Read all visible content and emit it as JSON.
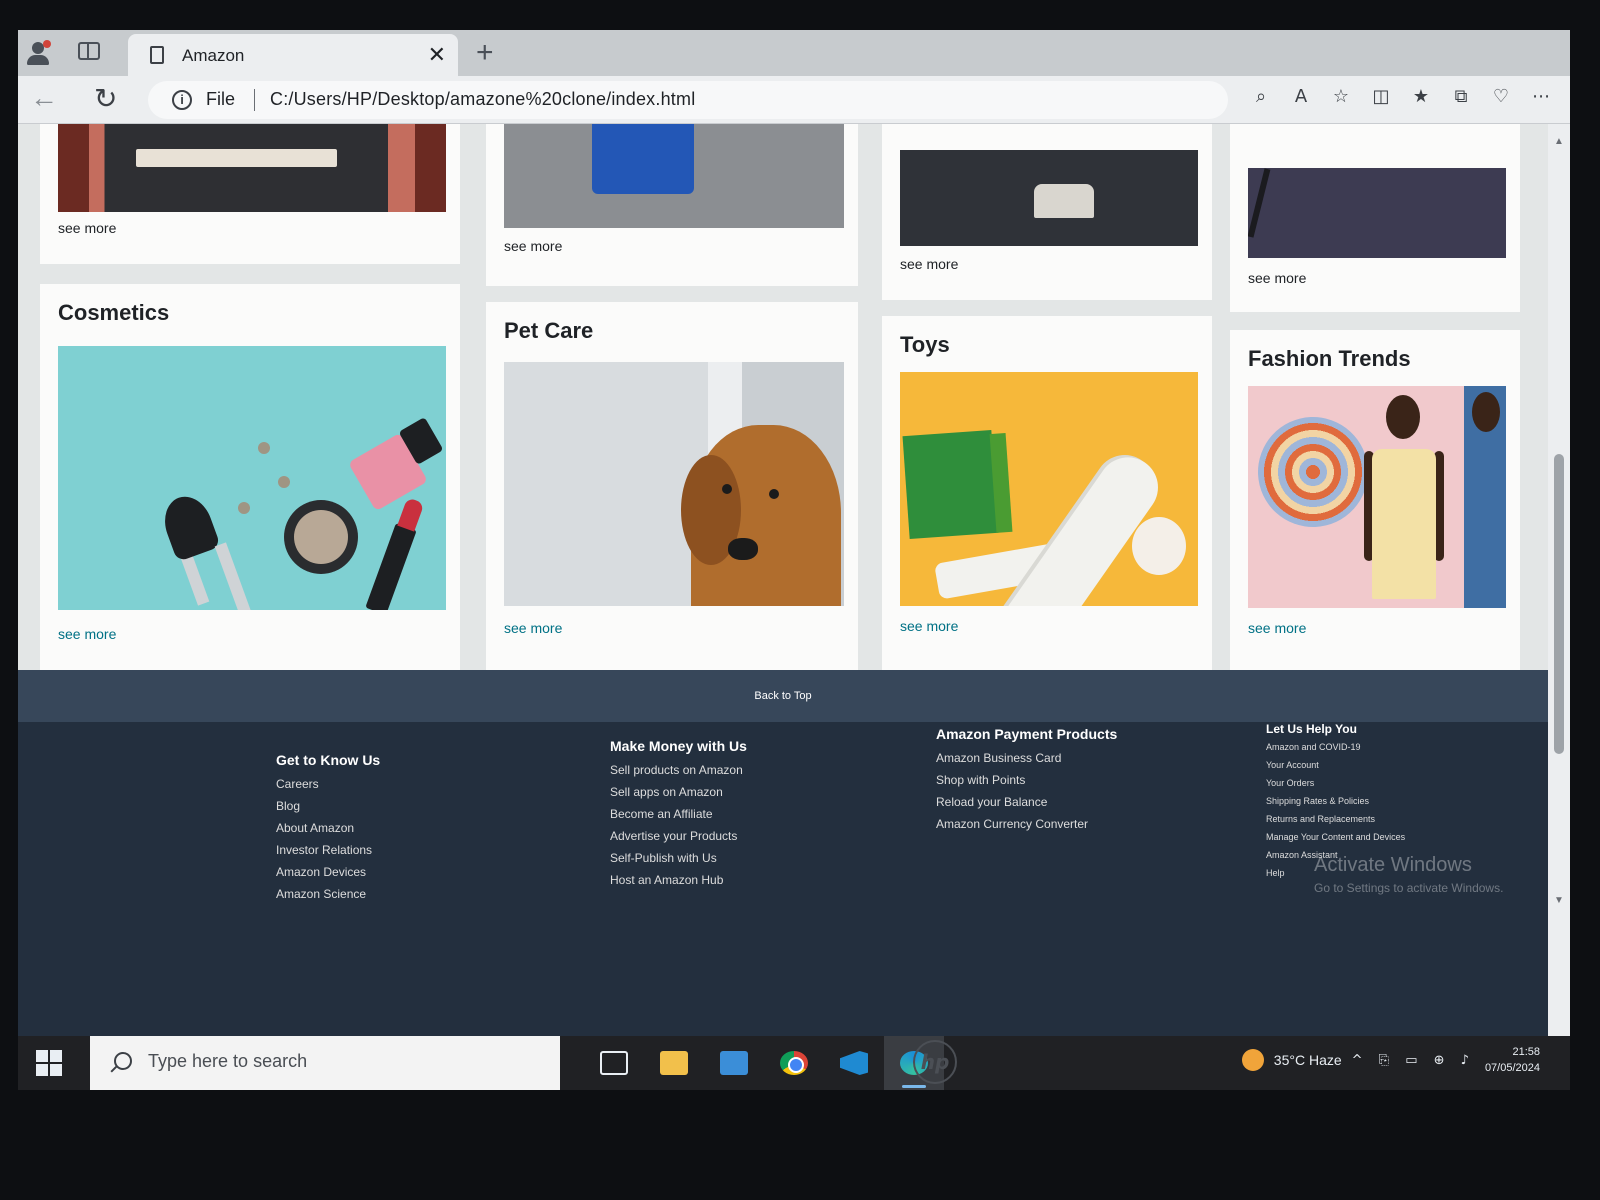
{
  "browser": {
    "tab_title": "Amazon",
    "address_prefix": "File",
    "url": "C:/Users/HP/Desktop/amazone%20clone/index.html"
  },
  "top_row": {
    "cards": [
      {
        "see_more": "see more"
      },
      {
        "see_more": "see more"
      },
      {
        "see_more": "see more"
      },
      {
        "see_more": "see more"
      }
    ]
  },
  "categories": [
    {
      "title": "Cosmetics",
      "see_more": "see more"
    },
    {
      "title": "Pet Care",
      "see_more": "see more"
    },
    {
      "title": "Toys",
      "see_more": "see more"
    },
    {
      "title": "Fashion Trends",
      "see_more": "see more"
    }
  ],
  "back_to_top": "Back to Top",
  "footer": {
    "col1": {
      "heading": "Get to Know Us",
      "links": [
        "Careers",
        "Blog",
        "About Amazon",
        "Investor Relations",
        "Amazon Devices",
        "Amazon Science"
      ]
    },
    "col2": {
      "heading": "Make Money with Us",
      "links": [
        "Sell products on Amazon",
        "Sell apps on Amazon",
        "Become an Affiliate",
        "Advertise your Products",
        "Self-Publish with Us",
        "Host an Amazon Hub"
      ]
    },
    "col3": {
      "heading": "Amazon Payment Products",
      "links": [
        "Amazon Business Card",
        "Shop with Points",
        "Reload your Balance",
        "Amazon Currency Converter"
      ]
    },
    "col4": {
      "heading": "Let Us Help You",
      "links": [
        "Amazon and COVID-19",
        "Your Account",
        "Your Orders",
        "Shipping Rates & Policies",
        "Returns and Replacements",
        "Manage Your Content and Devices",
        "Amazon Assistant",
        "Help"
      ]
    }
  },
  "watermark": {
    "line1": "Activate Windows",
    "line2": "Go to Settings to activate Windows."
  },
  "taskbar": {
    "search_placeholder": "Type here to search",
    "weather": "35°C  Haze",
    "time": "21:58",
    "date": "07/05/2024"
  }
}
